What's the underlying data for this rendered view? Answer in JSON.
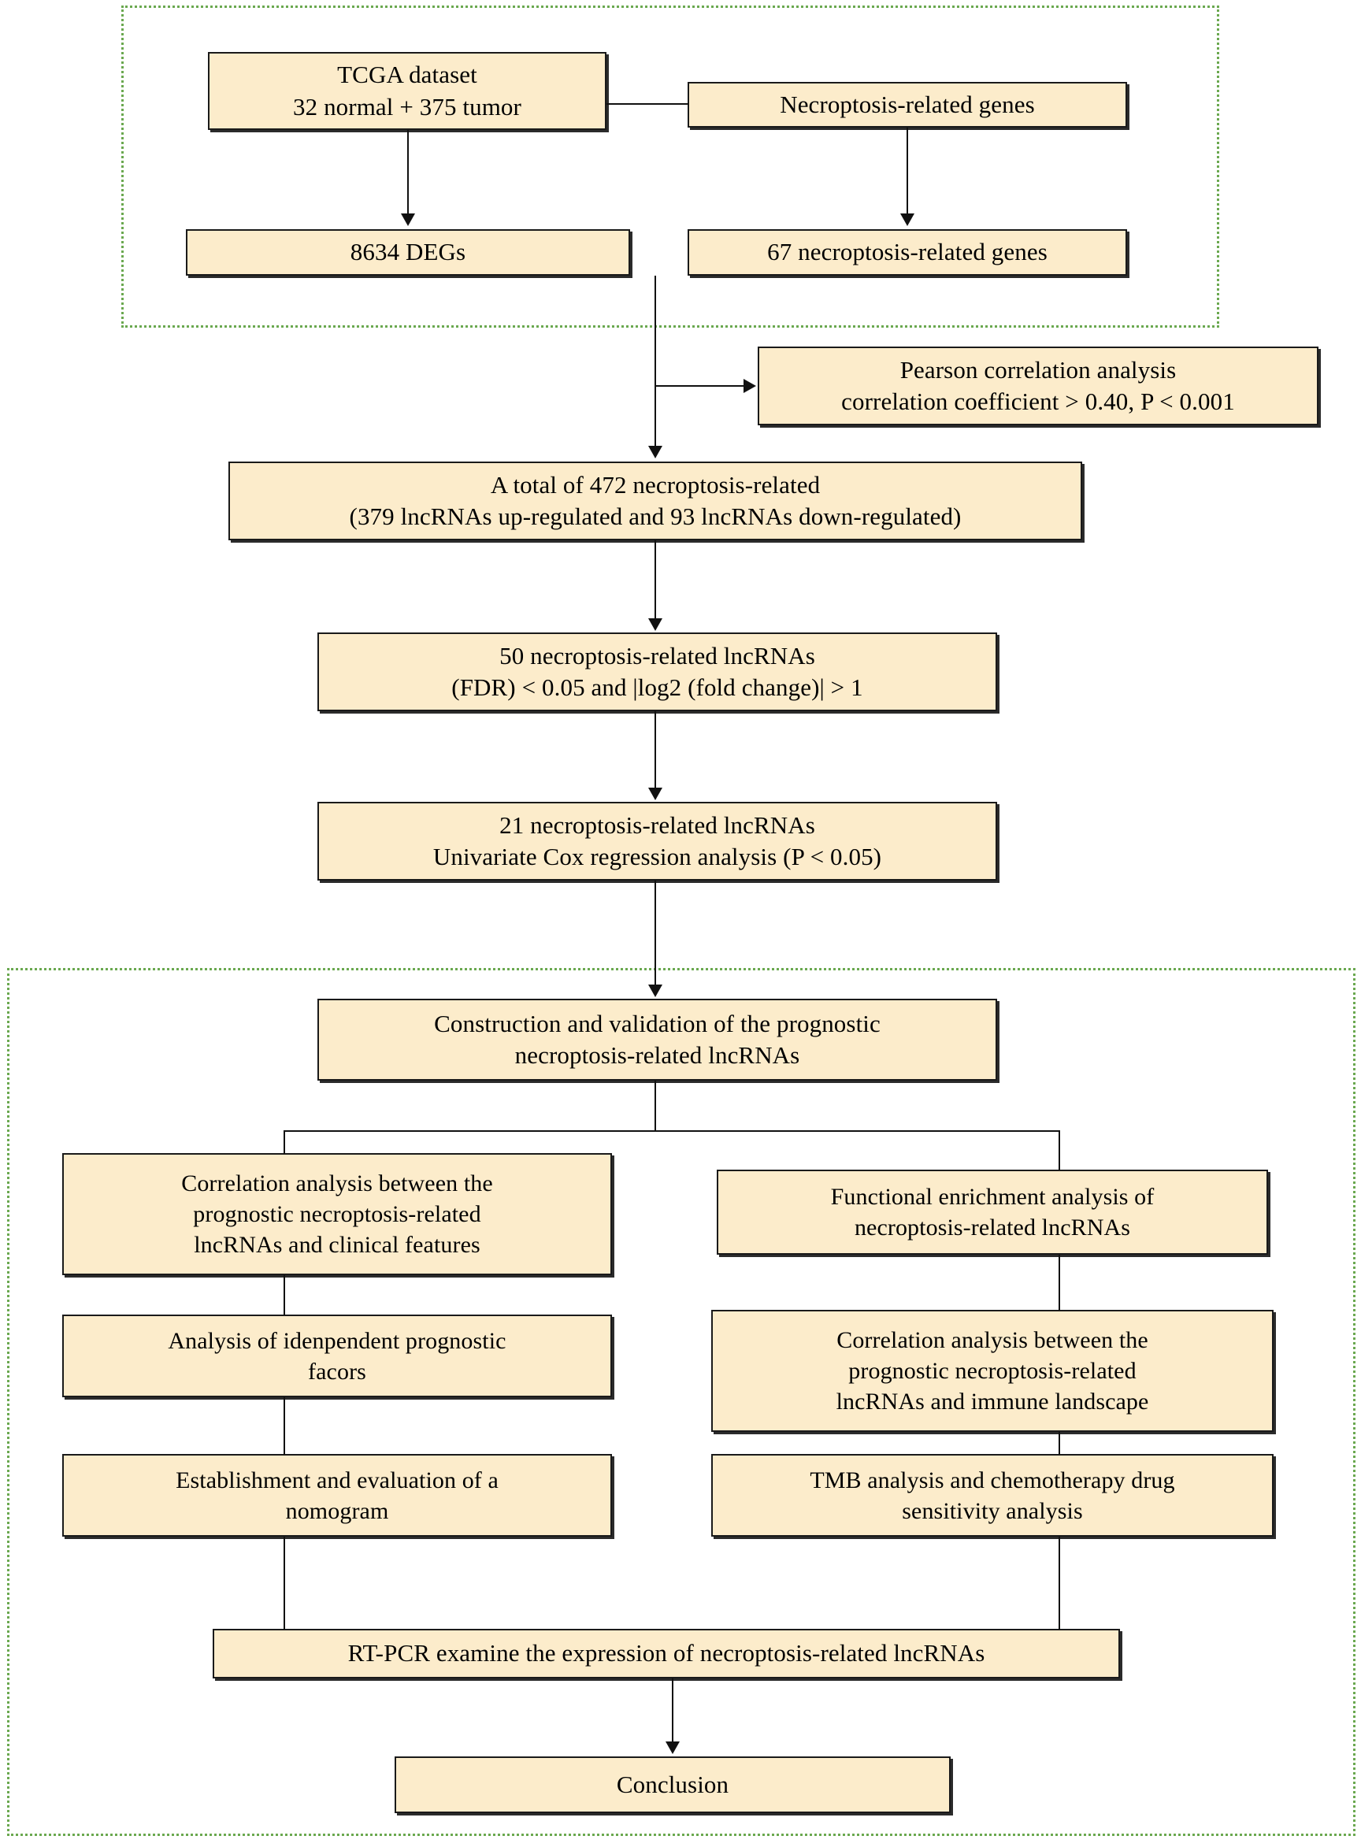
{
  "figure": {
    "type": "flowchart",
    "title": "Necroptosis-related lncRNA prognostic signature study workflow"
  },
  "regions": [
    {
      "name": "data-acquisition-region",
      "color": "#6aa84f"
    },
    {
      "name": "downstream-analysis-region",
      "color": "#6aa84f"
    }
  ],
  "nodes": {
    "tcga": {
      "line1": "TCGA dataset",
      "line2": "32 normal + 375 tumor"
    },
    "necroptosis_genes": {
      "line1": "Necroptosis-related genes"
    },
    "degs": {
      "line1": "8634 DEGs"
    },
    "necro_67": {
      "line1": "67 necroptosis-related genes"
    },
    "pearson": {
      "line1": "Pearson correlation analysis",
      "line2": "correlation coefficient > 0.40, P < 0.001"
    },
    "total472": {
      "line1": "A total of 472 necroptosis-related",
      "line2": "(379 lncRNAs up-regulated and 93 lncRNAs down-regulated)"
    },
    "lnc50": {
      "line1": "50 necroptosis-related lncRNAs",
      "line2": "(FDR) < 0.05 and |log2 (fold change)| > 1"
    },
    "lnc21": {
      "line1": "21 necroptosis-related lncRNAs",
      "line2": "Univariate Cox regression analysis (P < 0.05)"
    },
    "construction": {
      "line1": "Construction and validation of the prognostic",
      "line2": "necroptosis-related lncRNAs"
    },
    "corr_clinical": {
      "line1": "Correlation analysis between the",
      "line2": "prognostic necroptosis-related",
      "line3": "lncRNAs and clinical features"
    },
    "independent": {
      "line1": "Analysis of idenpendent prognostic",
      "line2": "facors"
    },
    "nomogram": {
      "line1": "Establishment and evaluation of a",
      "line2": "nomogram"
    },
    "functional": {
      "line1": "Functional enrichment analysis of",
      "line2": "necroptosis-related lncRNAs"
    },
    "immune": {
      "line1": "Correlation analysis between the",
      "line2": "prognostic necroptosis-related",
      "line3": "lncRNAs and immune landscape"
    },
    "tmb": {
      "line1": "TMB analysis and chemotherapy drug",
      "line2": "sensitivity analysis"
    },
    "rtpcr": {
      "line1": "RT-PCR examine the expression of necroptosis-related lncRNAs"
    },
    "conclusion": {
      "line1": "Conclusion"
    }
  },
  "colors": {
    "box_fill": "#fceccb",
    "box_border": "#1a1a1a",
    "region_border": "#6aa84f",
    "connector": "#111111",
    "background": "#ffffff"
  }
}
